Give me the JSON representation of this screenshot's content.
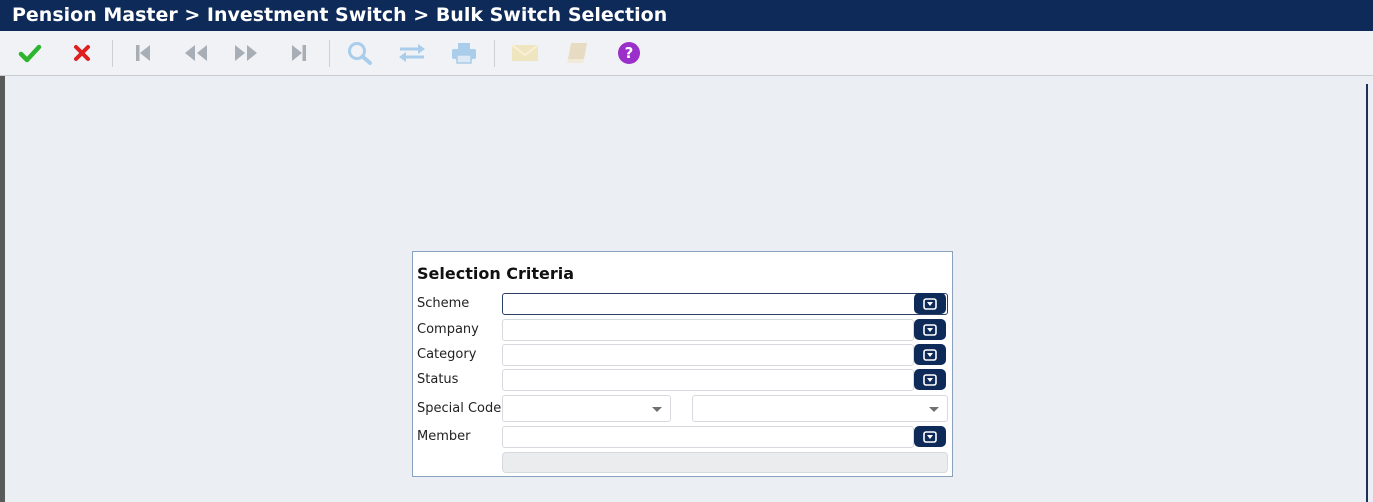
{
  "breadcrumb": "Pension Master > Investment Switch > Bulk Switch Selection",
  "toolbar": {
    "buttons": [
      {
        "name": "accept",
        "icon": "check-icon",
        "color": "#2db52d",
        "enabled": true
      },
      {
        "name": "cancel",
        "icon": "x-icon",
        "color": "#e02020",
        "enabled": true
      },
      {
        "name": "first",
        "icon": "first-record-icon",
        "color": "#a8aeb6",
        "enabled": false
      },
      {
        "name": "previous",
        "icon": "previous-record-icon",
        "color": "#a8aeb6",
        "enabled": false
      },
      {
        "name": "next",
        "icon": "next-record-icon",
        "color": "#a8aeb6",
        "enabled": false
      },
      {
        "name": "last",
        "icon": "last-record-icon",
        "color": "#a8aeb6",
        "enabled": false
      },
      {
        "name": "search",
        "icon": "search-icon",
        "color": "#a9cdea",
        "enabled": false
      },
      {
        "name": "switch",
        "icon": "swap-icon",
        "color": "#a9cdea",
        "enabled": false
      },
      {
        "name": "print",
        "icon": "print-icon",
        "color": "#a9cdea",
        "enabled": false
      },
      {
        "name": "mail",
        "icon": "mail-icon",
        "color": "#efe5bf",
        "enabled": false
      },
      {
        "name": "book",
        "icon": "book-icon",
        "color": "#e7dcc3",
        "enabled": false
      },
      {
        "name": "help",
        "icon": "help-icon",
        "color": "#9b2fc9",
        "enabled": true
      }
    ]
  },
  "selection": {
    "title": "Selection Criteria",
    "scheme_label": "Scheme",
    "scheme_value": "",
    "company_label": "Company",
    "company_value": "",
    "category_label": "Category",
    "category_value": "",
    "status_label": "Status",
    "status_value": "",
    "special_code_label": "Special Code",
    "special_code_value_1": "",
    "special_code_value_2": "",
    "member_label": "Member",
    "member_value": "",
    "member_name": ""
  }
}
